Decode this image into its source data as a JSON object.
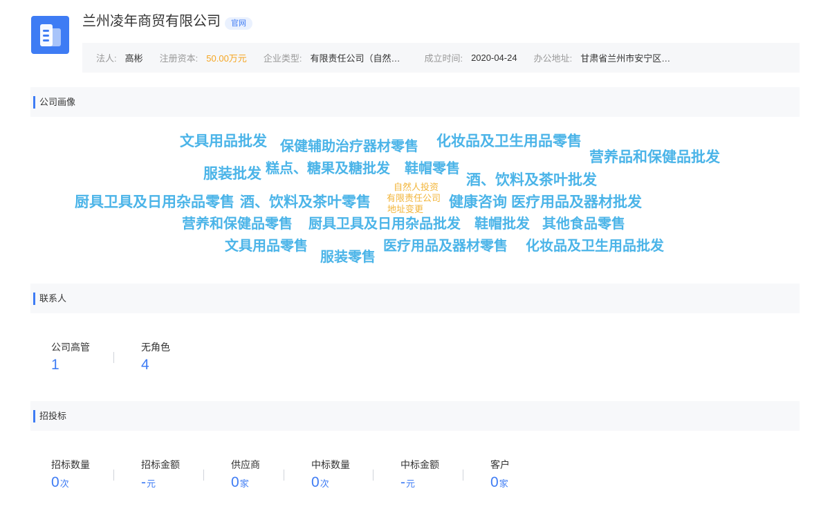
{
  "header": {
    "company_name": "兰州凌年商贸有限公司",
    "badge": "官网",
    "logo_icon": "building-icon",
    "colors": {
      "accent": "#3e7cf4",
      "money": "#f5a623"
    }
  },
  "info": {
    "legal_label": "法人:",
    "legal_value": "高彬",
    "capital_label": "注册资本:",
    "capital_value": "50.00万元",
    "type_label": "企业类型:",
    "type_value": "有限责任公司（自然…",
    "date_label": "成立时间:",
    "date_value": "2020-04-24",
    "address_label": "办公地址:",
    "address_value": "甘肃省兰州市安宁区…"
  },
  "sections": {
    "portrait_title": "公司画像",
    "contacts_title": "联系人",
    "bidding_title": "招投标"
  },
  "word_cloud": [
    {
      "text": "文具用品批发"
    },
    {
      "text": "保健辅助治疗器材零售"
    },
    {
      "text": "化妆品及卫生用品零售"
    },
    {
      "text": "营养品和保健品批发"
    },
    {
      "text": "服装批发"
    },
    {
      "text": "糕点、糖果及糖批发"
    },
    {
      "text": "鞋帽零售"
    },
    {
      "text": "酒、饮料及茶叶批发"
    },
    {
      "text": "自然人投资"
    },
    {
      "text": "厨具卫具及日用杂品零售"
    },
    {
      "text": "酒、饮料及茶叶零售"
    },
    {
      "text": "有限责任公司"
    },
    {
      "text": "健康咨询"
    },
    {
      "text": "医疗用品及器材批发"
    },
    {
      "text": "地址变更"
    },
    {
      "text": "营养和保健品零售"
    },
    {
      "text": "厨具卫具及日用杂品批发"
    },
    {
      "text": "鞋帽批发"
    },
    {
      "text": "其他食品零售"
    },
    {
      "text": "文具用品零售"
    },
    {
      "text": "服装零售"
    },
    {
      "text": "医疗用品及器材零售"
    },
    {
      "text": "化妆品及卫生用品批发"
    }
  ],
  "contacts": [
    {
      "label": "公司高管",
      "value": "1"
    },
    {
      "label": "无角色",
      "value": "4"
    }
  ],
  "bidding": [
    {
      "label": "招标数量",
      "value": "0",
      "unit": "次"
    },
    {
      "label": "招标金额",
      "value": "-",
      "unit": "元"
    },
    {
      "label": "供应商",
      "value": "0",
      "unit": "家"
    },
    {
      "label": "中标数量",
      "value": "0",
      "unit": "次"
    },
    {
      "label": "中标金额",
      "value": "-",
      "unit": "元"
    },
    {
      "label": "客户",
      "value": "0",
      "unit": "家"
    }
  ]
}
